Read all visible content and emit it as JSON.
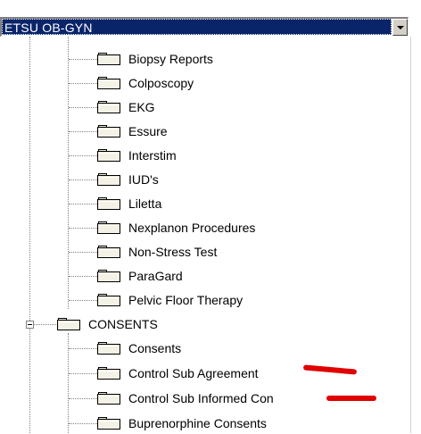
{
  "combo": {
    "selected": "ETSU OB-GYN"
  },
  "tree": {
    "subitems_a": [
      "Biopsy Reports",
      "Colposcopy",
      "EKG",
      "Essure",
      "Interstim",
      "IUD's",
      "Liletta",
      "Nexplanon Procedures",
      "Non-Stress Test",
      "ParaGard",
      "Pelvic Floor Therapy"
    ],
    "consents_label": "CONSENTS",
    "subitems_b": [
      "Consents",
      "Control Sub Agreement",
      "Control Sub Informed Con",
      "Buprenorphine Consents"
    ]
  },
  "colors": {
    "selection": "#0a246a",
    "redaction_mark": "#e00000"
  }
}
